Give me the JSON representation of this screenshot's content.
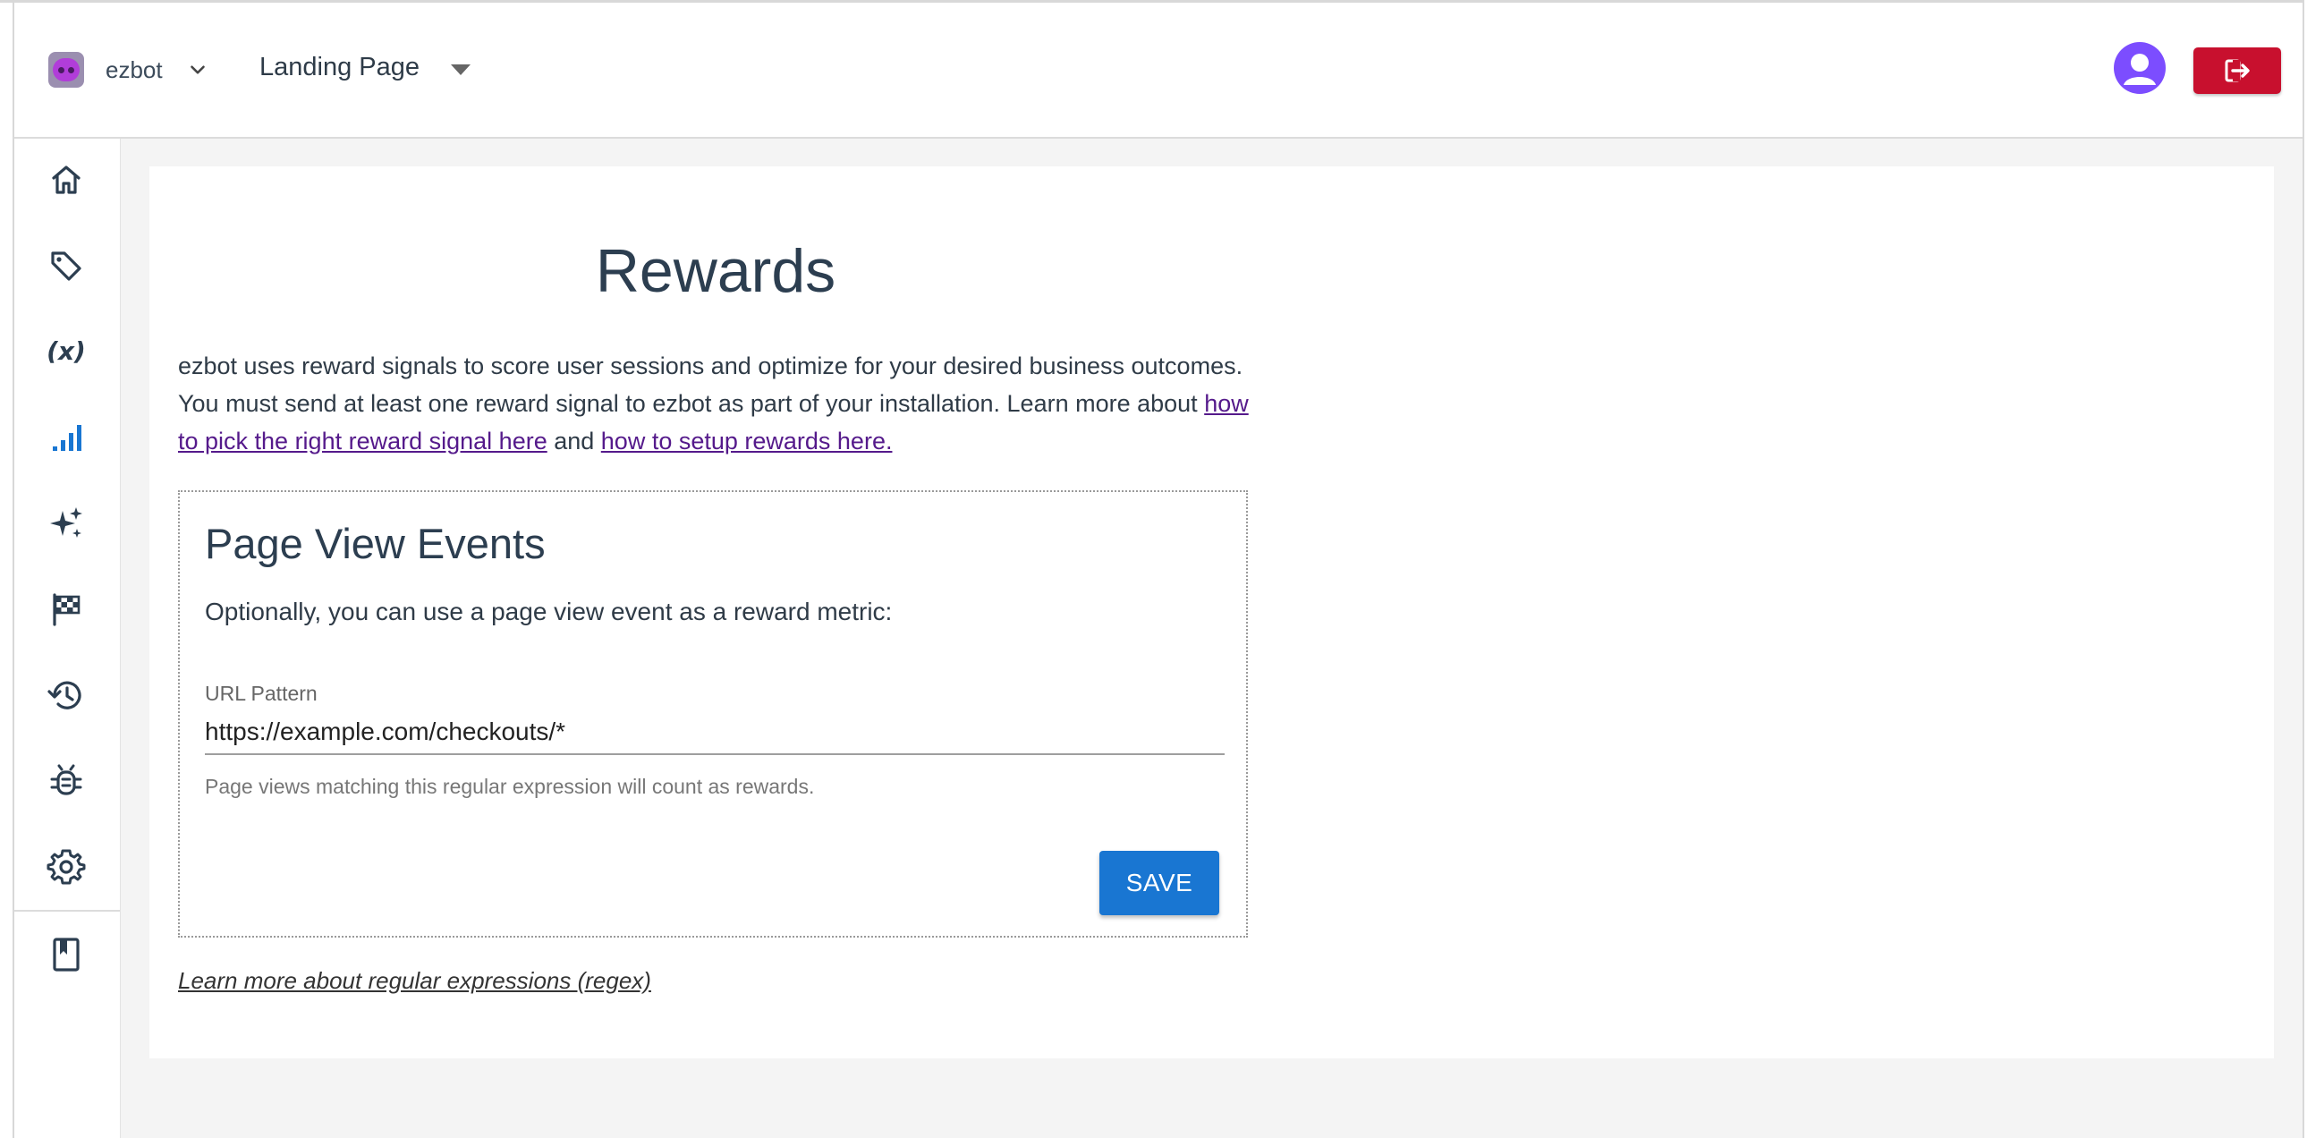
{
  "header": {
    "org_name": "ezbot",
    "page_selector": "Landing Page"
  },
  "sidebar": {
    "items": [
      {
        "name": "home"
      },
      {
        "name": "tag"
      },
      {
        "name": "variables",
        "glyph": "(x)"
      },
      {
        "name": "analytics",
        "active": true
      },
      {
        "name": "sparkle"
      },
      {
        "name": "flag"
      },
      {
        "name": "history"
      },
      {
        "name": "bug"
      },
      {
        "name": "settings"
      },
      {
        "name": "docs"
      }
    ]
  },
  "main": {
    "title": "Rewards",
    "intro_text": "ezbot uses reward signals to score user sessions and optimize for your desired business outcomes. You must send at least one reward signal to ezbot as part of your installation. Learn more about ",
    "link_pick_signal": "how to pick the right reward signal here",
    "intro_and": " and ",
    "link_setup_rewards": "how to setup rewards here.",
    "page_view_events": {
      "title": "Page View Events",
      "description": "Optionally, you can use a page view event as a reward metric:",
      "url_label": "URL Pattern",
      "url_value": "https://example.com/checkouts/*",
      "hint": "Page views matching this regular expression will count as rewards.",
      "save_label": "SAVE"
    },
    "regex_link": "Learn more about regular expressions (regex)"
  },
  "colors": {
    "primary": "#1976d2",
    "logout": "#c8102e",
    "avatar": "#7c4dff",
    "link": "#551a8b",
    "active_nav": "#1976d2",
    "nav_icon": "#2c3e50"
  }
}
